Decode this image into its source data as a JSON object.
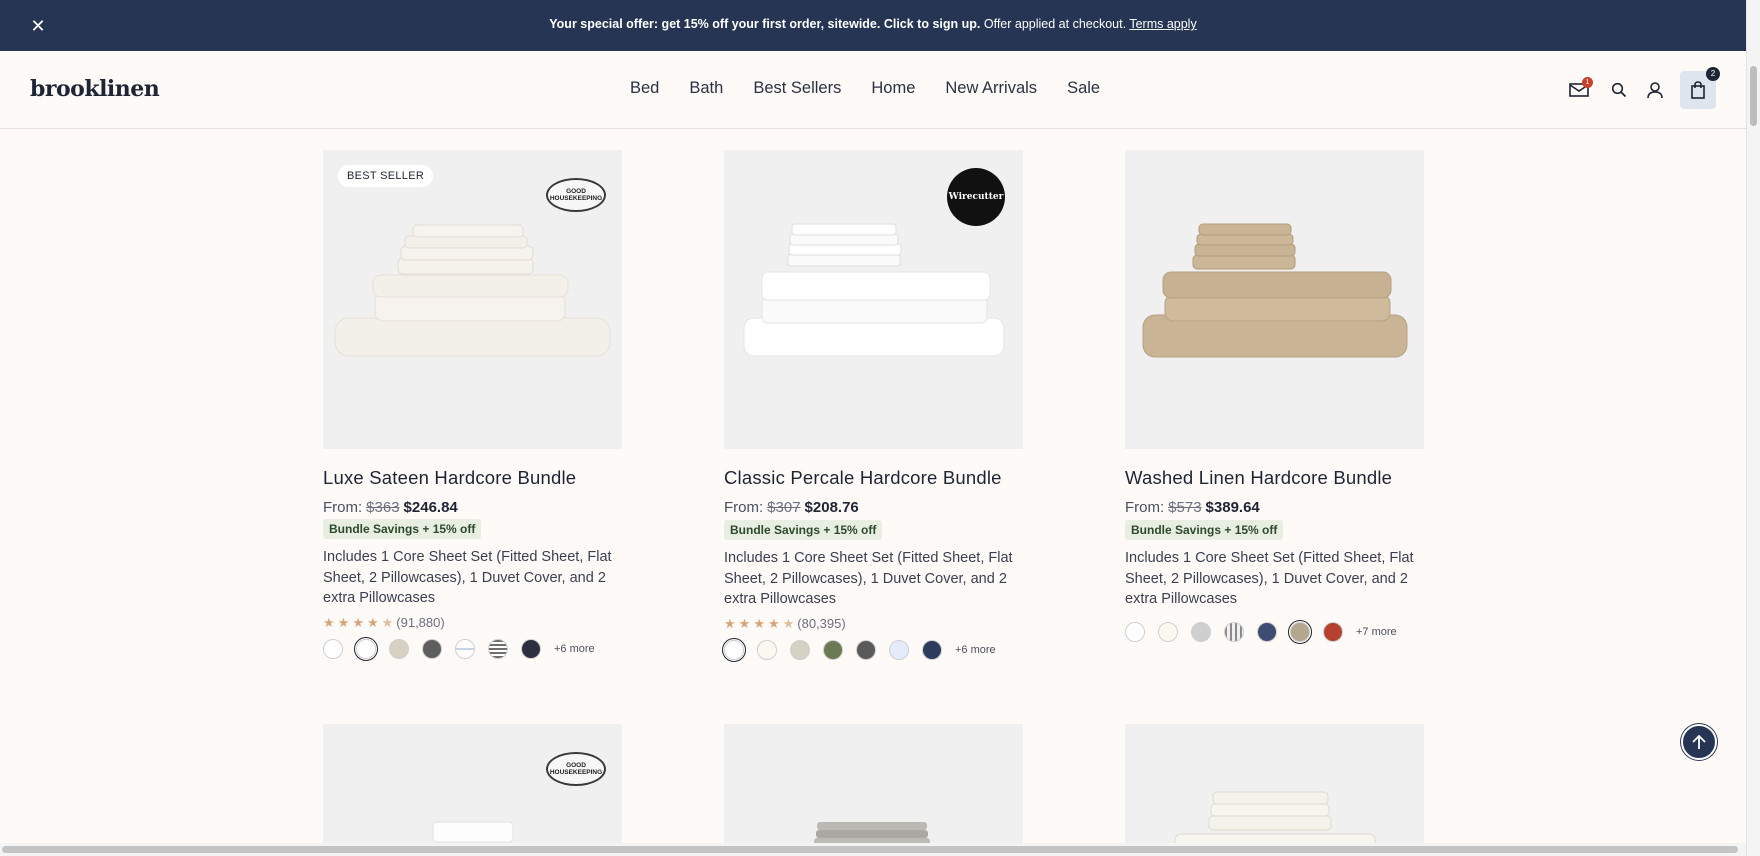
{
  "promo": {
    "bold": "Your special offer: get 15% off your first order, sitewide. Click to sign up.",
    "rest": "Offer applied at checkout.",
    "link": "Terms apply"
  },
  "header": {
    "logo": "brooklinen",
    "nav": [
      "Bed",
      "Bath",
      "Best Sellers",
      "Home",
      "New Arrivals",
      "Sale"
    ],
    "mail_badge": "1",
    "cart_count": "2"
  },
  "products": [
    {
      "title": "Luxe Sateen Hardcore Bundle",
      "from": "From:",
      "old_price": "$363",
      "price": "$246.84",
      "savings": "Bundle Savings + 15% off",
      "desc": "Includes 1 Core Sheet Set (Fitted Sheet, Flat Sheet, 2 Pillowcases), 1 Duvet Cover, and 2 extra Pillowcases",
      "badge": "BEST SELLER",
      "award": "GOOD HOUSEKEEPING",
      "rating": 4.5,
      "reviews": "(91,880)",
      "swatches": [
        "#ffffff",
        "#ffffff",
        "#d6d1c3",
        "#5e5e5e",
        "#ffffff",
        "#9a9a9a",
        "#2b2f3f"
      ],
      "more": "+6 more"
    },
    {
      "title": "Classic Percale Hardcore Bundle",
      "from": "From:",
      "old_price": "$307",
      "price": "$208.76",
      "savings": "Bundle Savings + 15% off",
      "desc": "Includes 1 Core Sheet Set (Fitted Sheet, Flat Sheet, 2 Pillowcases), 1 Duvet Cover, and 2 extra Pillowcases",
      "award": "Wirecutter",
      "rating": 4.5,
      "reviews": "(80,395)",
      "swatches": [
        "#ffffff",
        "#fbf8f2",
        "#d5d2c4",
        "#6b7a52",
        "#5a5a5a",
        "#e4ecfb",
        "#2d3c5c"
      ],
      "more": "+6 more"
    },
    {
      "title": "Washed Linen Hardcore Bundle",
      "from": "From:",
      "old_price": "$573",
      "price": "$389.64",
      "savings": "Bundle Savings + 15% off",
      "desc": "Includes 1 Core Sheet Set (Fitted Sheet, Flat Sheet, 2 Pillowcases), 1 Duvet Cover, and 2 extra Pillowcases",
      "swatches": [
        "#ffffff",
        "#fbf8f2",
        "#cfcfcf",
        "#d8d8d8",
        "#3e4b72",
        "#b3a88f",
        "#b5412e"
      ],
      "more": "+7 more"
    }
  ]
}
